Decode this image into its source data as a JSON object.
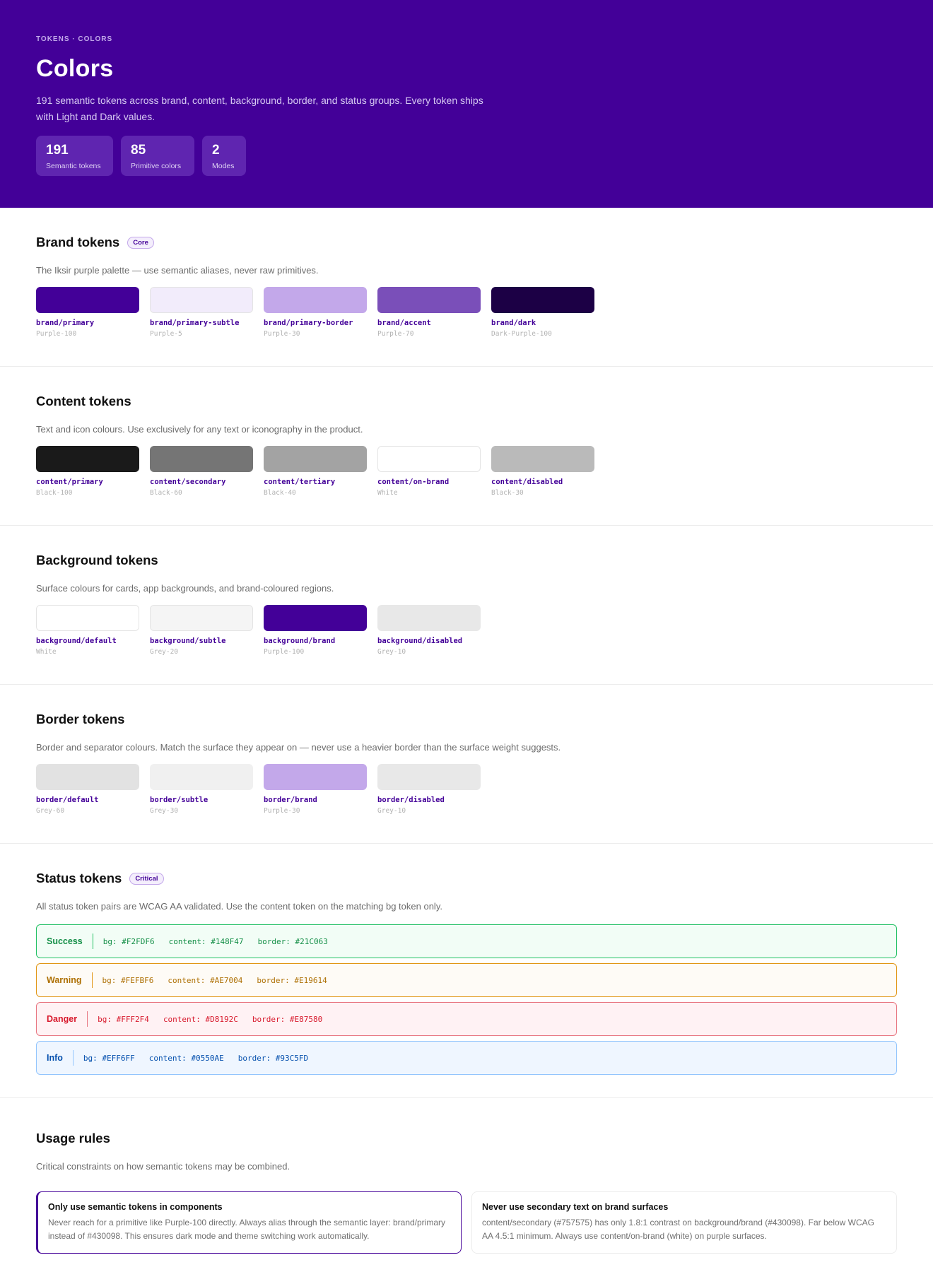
{
  "hero": {
    "eyebrow": "TOKENS · COLORS",
    "title": "Colors",
    "description": "191 semantic tokens across brand, content, background, border, and status groups. Every token ships with Light and Dark values.",
    "stats": [
      {
        "value": "191",
        "label": "Semantic tokens"
      },
      {
        "value": "85",
        "label": "Primitive colors"
      },
      {
        "value": "2",
        "label": "Modes"
      }
    ]
  },
  "brand": {
    "title": "Brand tokens",
    "badge": "Core",
    "description": "The Iksir purple palette — use semantic aliases, never raw primitives.",
    "tokens": [
      {
        "name": "brand/primary",
        "primitive": "Purple-100",
        "color": "#430098"
      },
      {
        "name": "brand/primary-subtle",
        "primitive": "Purple-5",
        "color": "#f2ecfb"
      },
      {
        "name": "brand/primary-border",
        "primitive": "Purple-30",
        "color": "#c3a8ea"
      },
      {
        "name": "brand/accent",
        "primitive": "Purple-70",
        "color": "#7a4fb9"
      },
      {
        "name": "brand/dark",
        "primitive": "Dark-Purple-100",
        "color": "#1c0045"
      }
    ]
  },
  "content": {
    "title": "Content tokens",
    "description": "Text and icon colours. Use exclusively for any text or iconography in the product.",
    "tokens": [
      {
        "name": "content/primary",
        "primitive": "Black-100",
        "color": "#1a1a1a"
      },
      {
        "name": "content/secondary",
        "primitive": "Black-60",
        "color": "#757575"
      },
      {
        "name": "content/tertiary",
        "primitive": "Black-40",
        "color": "#a3a3a3"
      },
      {
        "name": "content/on-brand",
        "primitive": "White",
        "color": "#ffffff"
      },
      {
        "name": "content/disabled",
        "primitive": "Black-30",
        "color": "#bababa"
      }
    ]
  },
  "background": {
    "title": "Background tokens",
    "description": "Surface colours for cards, app backgrounds, and brand-coloured regions.",
    "tokens": [
      {
        "name": "background/default",
        "primitive": "White",
        "color": "#ffffff"
      },
      {
        "name": "background/subtle",
        "primitive": "Grey-20",
        "color": "#f5f5f5"
      },
      {
        "name": "background/brand",
        "primitive": "Purple-100",
        "color": "#430098"
      },
      {
        "name": "background/disabled",
        "primitive": "Grey-10",
        "color": "#e8e8e8"
      }
    ]
  },
  "border": {
    "title": "Border tokens",
    "description": "Border and separator colours. Match the surface they appear on — never use a heavier border than the surface weight suggests.",
    "tokens": [
      {
        "name": "border/default",
        "primitive": "Grey-60",
        "color": "#e2e2e2"
      },
      {
        "name": "border/subtle",
        "primitive": "Grey-30",
        "color": "#f0f0f0"
      },
      {
        "name": "border/brand",
        "primitive": "Purple-30",
        "color": "#c3a8ea"
      },
      {
        "name": "border/disabled",
        "primitive": "Grey-10",
        "color": "#e8e8e8"
      }
    ]
  },
  "status": {
    "title": "Status tokens",
    "badge": "Critical",
    "description": "All status token pairs are WCAG AA validated. Use the content token on the matching bg token only.",
    "rows": [
      {
        "name": "Success",
        "bg": "bg: #F2FDF6",
        "content": "content: #148F47",
        "border": "border: #21C063",
        "bg_color": "#F2FDF6",
        "content_color": "#148F47",
        "border_color": "#21C063"
      },
      {
        "name": "Warning",
        "bg": "bg: #FEFBF6",
        "content": "content: #AE7004",
        "border": "border: #E19614",
        "bg_color": "#FEFBF6",
        "content_color": "#AE7004",
        "border_color": "#E19614"
      },
      {
        "name": "Danger",
        "bg": "bg: #FFF2F4",
        "content": "content: #D8192C",
        "border": "border: #E87580",
        "bg_color": "#FFF2F4",
        "content_color": "#D8192C",
        "border_color": "#E87580"
      },
      {
        "name": "Info",
        "bg": "bg: #EFF6FF",
        "content": "content: #0550AE",
        "border": "border: #93C5FD",
        "bg_color": "#EFF6FF",
        "content_color": "#0550AE",
        "border_color": "#93C5FD"
      }
    ]
  },
  "usage": {
    "title": "Usage rules",
    "description": "Critical constraints on how semantic tokens may be combined.",
    "rules": [
      {
        "title": "Only use semantic tokens in components",
        "body": "Never reach for a primitive like Purple-100 directly. Always alias through the semantic layer: brand/primary instead of #430098. This ensures dark mode and theme switching work automatically."
      },
      {
        "title": "Never use secondary text on brand surfaces",
        "body": "content/secondary (#757575) has only 1.8:1 contrast on background/brand (#430098). Far below WCAG AA 4.5:1 minimum. Always use content/on-brand (white) on purple surfaces."
      }
    ]
  }
}
